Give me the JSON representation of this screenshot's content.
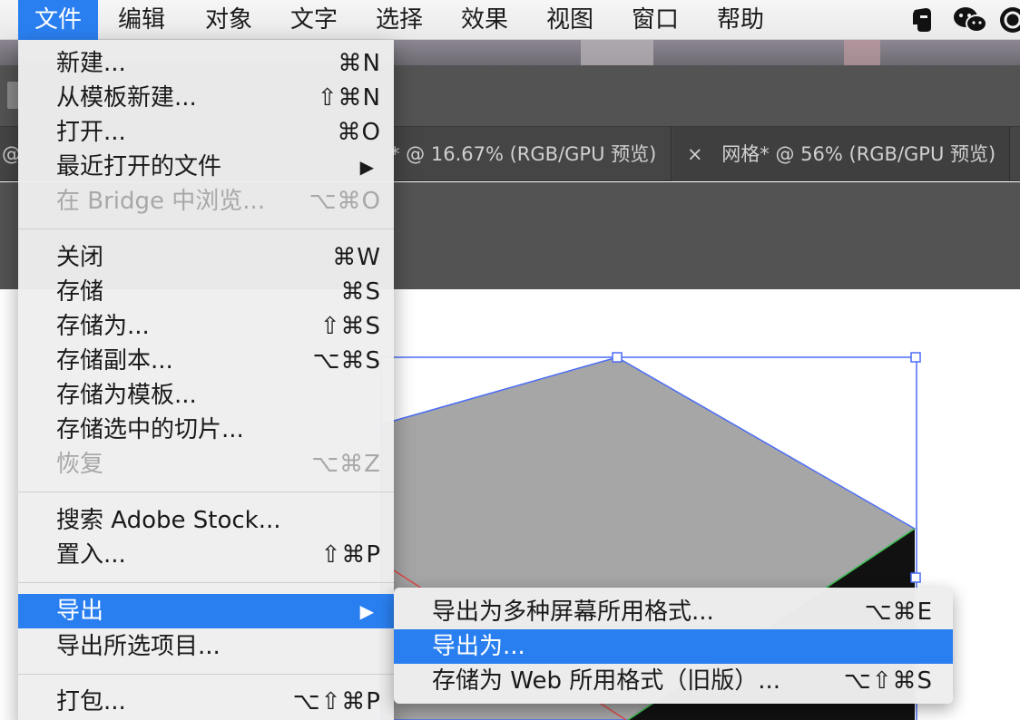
{
  "menubar": {
    "items": [
      "文件",
      "编辑",
      "对象",
      "文字",
      "选择",
      "效果",
      "视图",
      "窗口",
      "帮助"
    ],
    "active_index": 0
  },
  "tray": {
    "icons": [
      "evernote-icon",
      "wechat-icon",
      "app-icon"
    ]
  },
  "tabs": [
    {
      "prefix": "@",
      "label": "* @ 16.67% (RGB/GPU 预览)"
    },
    {
      "close": "×",
      "label": "网格* @ 56% (RGB/GPU 预览)"
    }
  ],
  "file_menu": {
    "items": [
      {
        "label": "新建...",
        "shortcut": "⌘N"
      },
      {
        "label": "从模板新建...",
        "shortcut": "⇧⌘N"
      },
      {
        "label": "打开...",
        "shortcut": "⌘O"
      },
      {
        "label": "最近打开的文件",
        "submenu": true
      },
      {
        "label": "在 Bridge 中浏览...",
        "shortcut": "⌥⌘O",
        "disabled": true
      },
      {
        "label": "关闭",
        "shortcut": "⌘W"
      },
      {
        "label": "存储",
        "shortcut": "⌘S"
      },
      {
        "label": "存储为...",
        "shortcut": "⇧⌘S"
      },
      {
        "label": "存储副本...",
        "shortcut": "⌥⌘S"
      },
      {
        "label": "存储为模板..."
      },
      {
        "label": "存储选中的切片..."
      },
      {
        "label": "恢复",
        "shortcut": "⌥⌘Z",
        "disabled": true
      },
      {
        "label": "搜索 Adobe Stock..."
      },
      {
        "label": "置入...",
        "shortcut": "⇧⌘P"
      },
      {
        "label": "导出",
        "submenu": true,
        "highlighted": true
      },
      {
        "label": "导出所选项目..."
      },
      {
        "label": "打包...",
        "shortcut": "⌥⇧⌘P"
      }
    ],
    "submenu_arrow": "▶"
  },
  "export_submenu": {
    "items": [
      {
        "label": "导出为多种屏幕所用格式...",
        "shortcut": "⌥⌘E"
      },
      {
        "label": "导出为...",
        "highlighted": true
      },
      {
        "label": "存储为 Web 所用格式（旧版）...",
        "shortcut": "⌥⇧⌘S"
      }
    ]
  },
  "colors": {
    "accent": "#2a7ff0",
    "selection": "#4a6cf7",
    "artwork_gray": "#a6a6a6",
    "artwork_dark": "#111111"
  }
}
